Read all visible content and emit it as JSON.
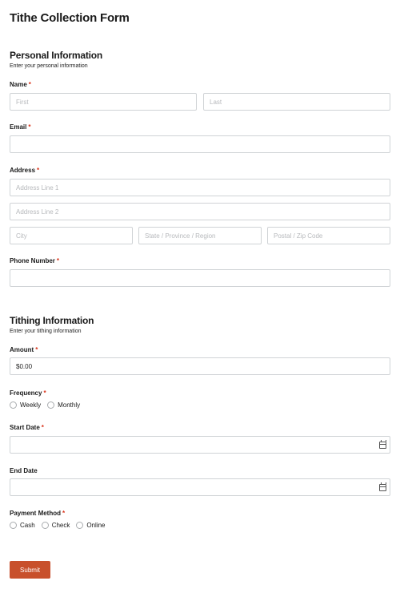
{
  "form": {
    "title": "Tithe Collection Form"
  },
  "personal": {
    "title": "Personal Information",
    "subtitle": "Enter your personal information",
    "name": {
      "label": "Name",
      "required": "*",
      "first_placeholder": "First",
      "last_placeholder": "Last"
    },
    "email": {
      "label": "Email",
      "required": "*",
      "value": ""
    },
    "address": {
      "label": "Address",
      "required": "*",
      "line1_placeholder": "Address Line 1",
      "line2_placeholder": "Address Line 2",
      "city_placeholder": "City",
      "state_placeholder": "State / Province / Region",
      "zip_placeholder": "Postal / Zip Code"
    },
    "phone": {
      "label": "Phone Number",
      "required": "*",
      "value": ""
    }
  },
  "tithing": {
    "title": "Tithing Information",
    "subtitle": "Enter your tithing information",
    "amount": {
      "label": "Amount",
      "required": "*",
      "value": "$0.00"
    },
    "frequency": {
      "label": "Frequency",
      "required": "*",
      "options": [
        "Weekly",
        "Monthly"
      ]
    },
    "start_date": {
      "label": "Start Date",
      "required": "*",
      "value": ""
    },
    "end_date": {
      "label": "End Date",
      "value": ""
    },
    "payment_method": {
      "label": "Payment Method",
      "required": "*",
      "options": [
        "Cash",
        "Check",
        "Online"
      ]
    }
  },
  "actions": {
    "submit_label": "Submit"
  },
  "colors": {
    "accent": "#c8502b",
    "required": "#d9331a",
    "border": "#d0d3d6"
  }
}
